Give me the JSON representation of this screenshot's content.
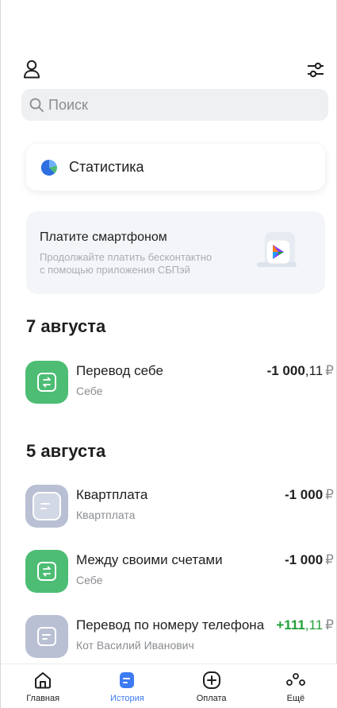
{
  "search": {
    "placeholder": "Поиск"
  },
  "stats_card": {
    "label": "Статистика"
  },
  "promo": {
    "title": "Платите смартфоном",
    "subtitle_line1": "Продолжайте платить бесконтактно",
    "subtitle_line2": "с помощью приложения СБПэй"
  },
  "groups": [
    {
      "date": "7 августа",
      "transactions": [
        {
          "title": "Перевод себе",
          "subtitle": "Себе",
          "amount_main": "-1 000",
          "amount_kop": ",11",
          "currency": "₽",
          "icon": "transfer-icon"
        }
      ]
    },
    {
      "date": "5 августа",
      "transactions": [
        {
          "title": "Квартплата",
          "subtitle": "Квартплата",
          "amount_main": "-1 000",
          "amount_kop": "",
          "currency": "₽",
          "icon": "document-icon"
        },
        {
          "title": "Между своими счетами",
          "subtitle": "Себе",
          "amount_main": "-1 000",
          "amount_kop": "",
          "currency": "₽",
          "icon": "transfer-icon"
        },
        {
          "title": "Перевод по номеру телефона",
          "subtitle": "Кот Василий Иванович",
          "amount_main": "+111",
          "amount_kop": ",11",
          "currency": "₽",
          "icon": "document-icon"
        }
      ]
    }
  ],
  "tabbar": {
    "tabs": [
      {
        "label": "Главная",
        "icon": "home-icon"
      },
      {
        "label": "История",
        "icon": "history-icon",
        "active": true
      },
      {
        "label": "Оплата",
        "icon": "plus-circle-icon"
      },
      {
        "label": "Ещё",
        "icon": "more-icon"
      }
    ]
  },
  "colors": {
    "accent": "#3d7bf2",
    "positive": "#21a038",
    "green_icon": "#4dbd74",
    "grey_icon": "#b9c0d4"
  }
}
